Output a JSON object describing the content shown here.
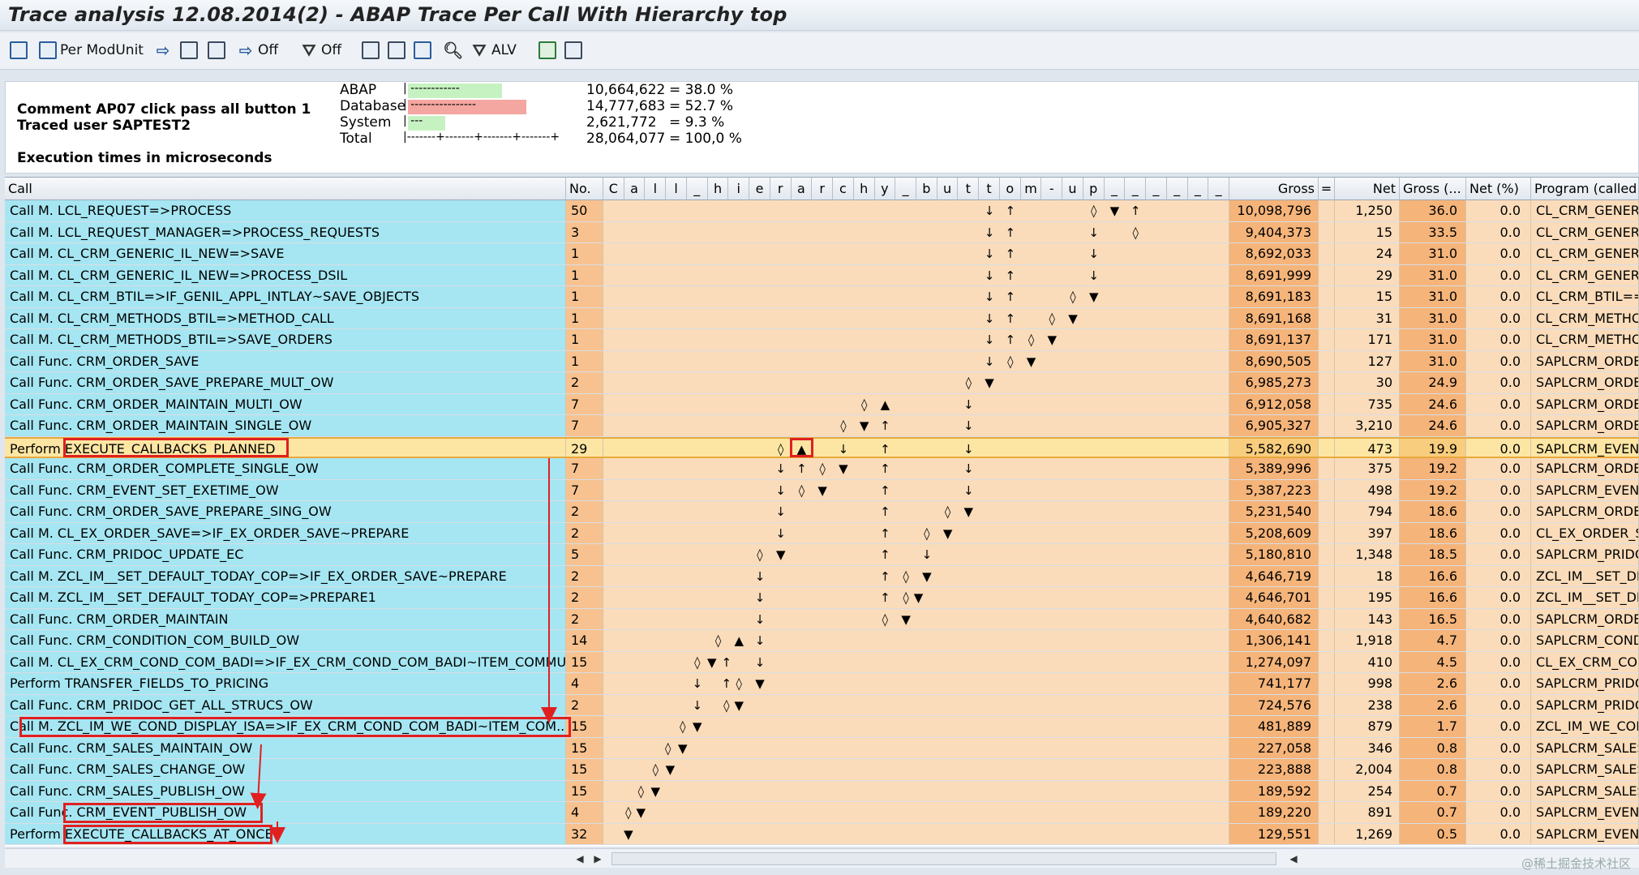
{
  "window": {
    "title": "Trace analysis 12.08.2014(2) - ABAP Trace Per Call With Hierarchy top"
  },
  "toolbar": {
    "per_modunit_label": "Per ModUnit",
    "off_label_1": "Off",
    "off_label_2": "Off",
    "alv_label": "ALV"
  },
  "summary": {
    "comment": "Comment AP07 click pass all button 1",
    "traced_user": "Traced user SAPTEST2",
    "exec_note": "Execution times in microseconds",
    "rows": [
      {
        "label": "ABAP",
        "bar": "|  ------------",
        "value": "10,664,622",
        "pct": "=  38.0 %",
        "color": "#c6f2c2"
      },
      {
        "label": "Database",
        "bar": "|  ----------------",
        "value": "14,777,683",
        "pct": "=  52.7 %",
        "color": "#f4a6a0"
      },
      {
        "label": "System",
        "bar": "|  ---",
        "value": "2,621,772",
        "pct": "=   9.3 %",
        "color": "#c6f2c2"
      },
      {
        "label": "Total",
        "bar": "|-------+-------+-------+-------+",
        "value": "28,064,077",
        "pct": "= 100,0 %",
        "color": ""
      }
    ]
  },
  "columns": {
    "call": "Call",
    "no": "No.",
    "hier_letters": [
      "C",
      "a",
      "l",
      "l",
      "_",
      "h",
      "i",
      "e",
      "r",
      "a",
      "r",
      "c",
      "h",
      "y",
      "_",
      "b",
      "u",
      "t",
      "t",
      "o",
      "m",
      "-",
      "u",
      "p",
      "_",
      "_",
      "_",
      "_",
      "_",
      "_"
    ],
    "gross": "Gross",
    "eq": "=",
    "net": "Net",
    "gross_pct": "Gross (...",
    "net_pct": "Net (%)",
    "program": "Program (called p"
  },
  "rows": [
    {
      "call": "Call M. LCL_REQUEST=>PROCESS",
      "no": "50",
      "gross": "10,098,796",
      "net": "1,250",
      "gp": "36.0",
      "np": "0.0",
      "prog": "CL_CRM_GENERIC",
      "sym": [
        [
          18,
          "↓"
        ],
        [
          19,
          "↑"
        ],
        [
          23,
          "◊"
        ],
        [
          24,
          "▼"
        ],
        [
          25,
          "↑"
        ]
      ]
    },
    {
      "call": "Call M. LCL_REQUEST_MANAGER=>PROCESS_REQUESTS",
      "no": "3",
      "gross": "9,404,373",
      "net": "15",
      "gp": "33.5",
      "np": "0.0",
      "prog": "CL_CRM_GENERIC",
      "sym": [
        [
          18,
          "↓"
        ],
        [
          19,
          "↑"
        ],
        [
          23,
          "↓"
        ],
        [
          25,
          "◊"
        ]
      ]
    },
    {
      "call": "Call M. CL_CRM_GENERIC_IL_NEW=>SAVE",
      "no": "1",
      "gross": "8,692,033",
      "net": "24",
      "gp": "31.0",
      "np": "0.0",
      "prog": "CL_CRM_GENERIC",
      "sym": [
        [
          18,
          "↓"
        ],
        [
          19,
          "↑"
        ],
        [
          23,
          "↓"
        ]
      ]
    },
    {
      "call": "Call M. CL_CRM_GENERIC_IL_NEW=>PROCESS_DSIL",
      "no": "1",
      "gross": "8,691,999",
      "net": "29",
      "gp": "31.0",
      "np": "0.0",
      "prog": "CL_CRM_GENERIC",
      "sym": [
        [
          18,
          "↓"
        ],
        [
          19,
          "↑"
        ],
        [
          23,
          "↓"
        ]
      ]
    },
    {
      "call": "Call M. CL_CRM_BTIL=>IF_GENIL_APPL_INTLAY~SAVE_OBJECTS",
      "no": "1",
      "gross": "8,691,183",
      "net": "15",
      "gp": "31.0",
      "np": "0.0",
      "prog": "CL_CRM_BTIL===",
      "sym": [
        [
          18,
          "↓"
        ],
        [
          19,
          "↑"
        ],
        [
          22,
          "◊"
        ],
        [
          23,
          "▼"
        ]
      ]
    },
    {
      "call": "Call M. CL_CRM_METHODS_BTIL=>METHOD_CALL",
      "no": "1",
      "gross": "8,691,168",
      "net": "31",
      "gp": "31.0",
      "np": "0.0",
      "prog": "CL_CRM_METHOD",
      "sym": [
        [
          18,
          "↓"
        ],
        [
          19,
          "↑"
        ],
        [
          21,
          "◊"
        ],
        [
          22,
          "▼"
        ]
      ]
    },
    {
      "call": "Call M. CL_CRM_METHODS_BTIL=>SAVE_ORDERS",
      "no": "1",
      "gross": "8,691,137",
      "net": "171",
      "gp": "31.0",
      "np": "0.0",
      "prog": "CL_CRM_METHOD",
      "sym": [
        [
          18,
          "↓"
        ],
        [
          19,
          "↑"
        ],
        [
          20,
          "◊"
        ],
        [
          21,
          "▼"
        ]
      ]
    },
    {
      "call": "Call Func. CRM_ORDER_SAVE",
      "no": "1",
      "gross": "8,690,505",
      "net": "127",
      "gp": "31.0",
      "np": "0.0",
      "prog": "SAPLCRM_ORDER",
      "sym": [
        [
          18,
          "↓"
        ],
        [
          19,
          "◊"
        ],
        [
          20,
          "▼"
        ]
      ]
    },
    {
      "call": "Call Func. CRM_ORDER_SAVE_PREPARE_MULT_OW",
      "no": "2",
      "gross": "6,985,273",
      "net": "30",
      "gp": "24.9",
      "np": "0.0",
      "prog": "SAPLCRM_ORDER",
      "sym": [
        [
          17,
          "◊"
        ],
        [
          18,
          "▼"
        ]
      ]
    },
    {
      "call": "Call Func. CRM_ORDER_MAINTAIN_MULTI_OW",
      "no": "7",
      "gross": "6,912,058",
      "net": "735",
      "gp": "24.6",
      "np": "0.0",
      "prog": "SAPLCRM_ORDER",
      "sym": [
        [
          12,
          "◊"
        ],
        [
          13,
          "▲"
        ],
        [
          17,
          "↓"
        ]
      ]
    },
    {
      "call": "Call Func. CRM_ORDER_MAINTAIN_SINGLE_OW",
      "no": "7",
      "gross": "6,905,327",
      "net": "3,210",
      "gp": "24.6",
      "np": "0.0",
      "prog": "SAPLCRM_ORDER",
      "sym": [
        [
          11,
          "◊"
        ],
        [
          12,
          "▼"
        ],
        [
          13,
          "↑"
        ],
        [
          17,
          "↓"
        ]
      ]
    },
    {
      "call": "Perform EXECUTE_CALLBACKS_PLANNED",
      "no": "29",
      "gross": "5,582,690",
      "net": "473",
      "gp": "19.9",
      "np": "0.0",
      "prog": "SAPLCRM_EVENT",
      "sel": true,
      "sym": [
        [
          8,
          "◊"
        ],
        [
          9,
          "▲"
        ],
        [
          11,
          "↓"
        ],
        [
          13,
          "↑"
        ],
        [
          17,
          "↓"
        ]
      ]
    },
    {
      "call": "Call Func. CRM_ORDER_COMPLETE_SINGLE_OW",
      "no": "7",
      "gross": "5,389,996",
      "net": "375",
      "gp": "19.2",
      "np": "0.0",
      "prog": "SAPLCRM_ORDER",
      "sym": [
        [
          8,
          "↓"
        ],
        [
          9,
          "↑"
        ],
        [
          10,
          "◊"
        ],
        [
          11,
          "▼"
        ],
        [
          13,
          "↑"
        ],
        [
          17,
          "↓"
        ]
      ]
    },
    {
      "call": "Call Func. CRM_EVENT_SET_EXETIME_OW",
      "no": "7",
      "gross": "5,387,223",
      "net": "498",
      "gp": "19.2",
      "np": "0.0",
      "prog": "SAPLCRM_EVENT",
      "sym": [
        [
          8,
          "↓"
        ],
        [
          9,
          "◊"
        ],
        [
          10,
          "▼"
        ],
        [
          13,
          "↑"
        ],
        [
          17,
          "↓"
        ]
      ]
    },
    {
      "call": "Call Func. CRM_ORDER_SAVE_PREPARE_SING_OW",
      "no": "2",
      "gross": "5,231,540",
      "net": "794",
      "gp": "18.6",
      "np": "0.0",
      "prog": "SAPLCRM_ORDER",
      "sym": [
        [
          8,
          "↓"
        ],
        [
          13,
          "↑"
        ],
        [
          16,
          "◊"
        ],
        [
          17,
          "▼"
        ]
      ]
    },
    {
      "call": "Call M. CL_EX_ORDER_SAVE=>IF_EX_ORDER_SAVE~PREPARE",
      "no": "2",
      "gross": "5,208,609",
      "net": "397",
      "gp": "18.6",
      "np": "0.0",
      "prog": "CL_EX_ORDER_S/",
      "sym": [
        [
          8,
          "↓"
        ],
        [
          13,
          "↑"
        ],
        [
          15,
          "◊"
        ],
        [
          16,
          "▼"
        ]
      ]
    },
    {
      "call": "Call Func. CRM_PRIDOC_UPDATE_EC",
      "no": "5",
      "gross": "5,180,810",
      "net": "1,348",
      "gp": "18.5",
      "np": "0.0",
      "prog": "SAPLCRM_PRIDOC",
      "sym": [
        [
          7,
          "◊"
        ],
        [
          8,
          "▼"
        ],
        [
          13,
          "↑"
        ],
        [
          15,
          "↓"
        ]
      ]
    },
    {
      "call": "Call M. ZCL_IM__SET_DEFAULT_TODAY_COP=>IF_EX_ORDER_SAVE~PREPARE",
      "no": "2",
      "gross": "4,646,719",
      "net": "18",
      "gp": "16.6",
      "np": "0.0",
      "prog": "ZCL_IM__SET_DE",
      "sym": [
        [
          7,
          "↓"
        ],
        [
          13,
          "↑"
        ],
        [
          14,
          "◊"
        ],
        [
          15,
          "▼"
        ]
      ]
    },
    {
      "call": "Call M. ZCL_IM__SET_DEFAULT_TODAY_COP=>PREPARE1",
      "no": "2",
      "gross": "4,646,701",
      "net": "195",
      "gp": "16.6",
      "np": "0.0",
      "prog": "ZCL_IM__SET_DE",
      "sym": [
        [
          7,
          "↓"
        ],
        [
          13,
          "↑"
        ],
        [
          14,
          "◊"
        ],
        [
          14.6,
          "▼"
        ]
      ]
    },
    {
      "call": "Call Func. CRM_ORDER_MAINTAIN",
      "no": "2",
      "gross": "4,640,682",
      "net": "143",
      "gp": "16.5",
      "np": "0.0",
      "prog": "SAPLCRM_ORDER",
      "sym": [
        [
          7,
          "↓"
        ],
        [
          13,
          "◊"
        ],
        [
          14,
          "▼"
        ]
      ]
    },
    {
      "call": "Call Func. CRM_CONDITION_COM_BUILD_OW",
      "no": "14",
      "gross": "1,306,141",
      "net": "1,918",
      "gp": "4.7",
      "np": "0.0",
      "prog": "SAPLCRM_CONDI",
      "sym": [
        [
          5,
          "◊"
        ],
        [
          6,
          "▲"
        ],
        [
          7,
          "↓"
        ]
      ]
    },
    {
      "call": "Call M. CL_EX_CRM_COND_COM_BADI=>IF_EX_CRM_COND_COM_BADI~ITEM_COMMU...",
      "no": "15",
      "gross": "1,274,097",
      "net": "410",
      "gp": "4.5",
      "np": "0.0",
      "prog": "CL_EX_CRM_CON",
      "sym": [
        [
          4,
          "◊"
        ],
        [
          4.7,
          "▼"
        ],
        [
          5.4,
          "↑"
        ],
        [
          7,
          "↓"
        ]
      ]
    },
    {
      "call": "Perform TRANSFER_FIELDS_TO_PRICING",
      "no": "4",
      "gross": "741,177",
      "net": "998",
      "gp": "2.6",
      "np": "0.0",
      "prog": "SAPLCRM_PRIDO",
      "sym": [
        [
          4,
          "↓"
        ],
        [
          5.4,
          "↑"
        ],
        [
          6,
          "◊"
        ],
        [
          7,
          "▼"
        ]
      ]
    },
    {
      "call": "Call Func. CRM_PRIDOC_GET_ALL_STRUCS_OW",
      "no": "2",
      "gross": "724,576",
      "net": "238",
      "gp": "2.6",
      "np": "0.0",
      "prog": "SAPLCRM_PRIDO",
      "sym": [
        [
          4,
          "↓"
        ],
        [
          5.4,
          "◊"
        ],
        [
          6,
          "▼"
        ]
      ]
    },
    {
      "call": "Call M. ZCL_IM_WE_COND_DISPLAY_ISA=>IF_EX_CRM_COND_COM_BADI~ITEM_COM...",
      "no": "15",
      "gross": "481,889",
      "net": "879",
      "gp": "1.7",
      "np": "0.0",
      "prog": "ZCL_IM_WE_CON",
      "sym": [
        [
          3.3,
          "◊"
        ],
        [
          4,
          "▼"
        ]
      ]
    },
    {
      "call": "Call Func. CRM_SALES_MAINTAIN_OW",
      "no": "15",
      "gross": "227,058",
      "net": "346",
      "gp": "0.8",
      "np": "0.0",
      "prog": "SAPLCRM_SALES",
      "sym": [
        [
          2.6,
          "◊"
        ],
        [
          3.3,
          "▼"
        ]
      ]
    },
    {
      "call": "Call Func. CRM_SALES_CHANGE_OW",
      "no": "15",
      "gross": "223,888",
      "net": "2,004",
      "gp": "0.8",
      "np": "0.0",
      "prog": "SAPLCRM_SALES",
      "sym": [
        [
          2,
          "◊"
        ],
        [
          2.7,
          "▼"
        ]
      ]
    },
    {
      "call": "Call Func. CRM_SALES_PUBLISH_OW",
      "no": "15",
      "gross": "189,592",
      "net": "254",
      "gp": "0.7",
      "np": "0.0",
      "prog": "SAPLCRM_SALES",
      "sym": [
        [
          1.3,
          "◊"
        ],
        [
          2,
          "▼"
        ]
      ]
    },
    {
      "call": "Call Func. CRM_EVENT_PUBLISH_OW",
      "no": "4",
      "gross": "189,220",
      "net": "891",
      "gp": "0.7",
      "np": "0.0",
      "prog": "SAPLCRM_EVENT",
      "sym": [
        [
          0.7,
          "◊"
        ],
        [
          1.3,
          "▼"
        ]
      ]
    },
    {
      "call": "Perform EXECUTE_CALLBACKS_AT_ONCE",
      "no": "32",
      "gross": "129,551",
      "net": "1,269",
      "gp": "0.5",
      "np": "0.0",
      "prog": "SAPLCRM_EVENT",
      "sym": [
        [
          0.7,
          "▼"
        ]
      ]
    }
  ],
  "watermark": "@稀土掘金技术社区"
}
